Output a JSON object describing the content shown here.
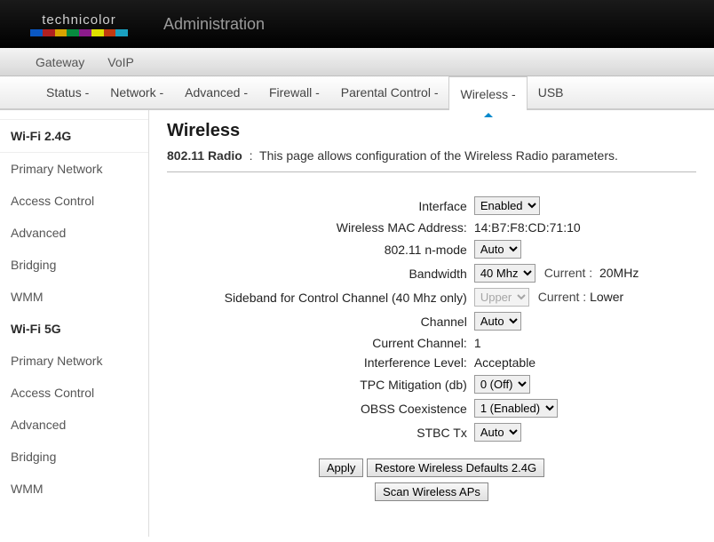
{
  "header": {
    "brand": "technicolor",
    "title": "Administration"
  },
  "subnav": [
    "Gateway",
    "VoIP"
  ],
  "menubar": [
    {
      "label": "Status -"
    },
    {
      "label": "Network -"
    },
    {
      "label": "Advanced -"
    },
    {
      "label": "Firewall -"
    },
    {
      "label": "Parental Control -"
    },
    {
      "label": "Wireless -",
      "active": true
    },
    {
      "label": "USB"
    }
  ],
  "sidebar": [
    {
      "label": "Wi-Fi 2.4G",
      "bold": true,
      "active": true
    },
    {
      "label": "Primary Network"
    },
    {
      "label": "Access Control"
    },
    {
      "label": "Advanced"
    },
    {
      "label": "Bridging"
    },
    {
      "label": "WMM"
    },
    {
      "label": "Wi-Fi 5G",
      "bold": true
    },
    {
      "label": "Primary Network"
    },
    {
      "label": "Access Control"
    },
    {
      "label": "Advanced"
    },
    {
      "label": "Bridging"
    },
    {
      "label": "WMM"
    }
  ],
  "page": {
    "title": "Wireless",
    "section": "802.11 Radio",
    "sep": ":",
    "description": "This page allows configuration of the Wireless Radio parameters."
  },
  "form": {
    "interface": {
      "label": "Interface",
      "value": "Enabled"
    },
    "mac": {
      "label": "Wireless MAC Address:",
      "value": "14:B7:F8:CD:71:10"
    },
    "nmode": {
      "label": "802.11 n-mode",
      "value": "Auto"
    },
    "bandwidth": {
      "label": "Bandwidth",
      "value": "40 Mhz",
      "current_label": "Current :",
      "current_value": "20MHz"
    },
    "sideband": {
      "label": "Sideband for Control Channel (40 Mhz only)",
      "value": "Upper",
      "disabled": true,
      "current_label": "Current :",
      "current_value": "Lower"
    },
    "channel": {
      "label": "Channel",
      "value": "Auto"
    },
    "cur_channel": {
      "label": "Current Channel:",
      "value": "1"
    },
    "interference": {
      "label": "Interference Level:",
      "value": "Acceptable"
    },
    "tpc": {
      "label": "TPC Mitigation (db)",
      "value": "0 (Off)"
    },
    "obss": {
      "label": "OBSS Coexistence",
      "value": "1 (Enabled)"
    },
    "stbc": {
      "label": "STBC Tx",
      "value": "Auto"
    }
  },
  "buttons": {
    "apply": "Apply",
    "restore": "Restore Wireless Defaults 2.4G",
    "scan": "Scan Wireless APs"
  }
}
